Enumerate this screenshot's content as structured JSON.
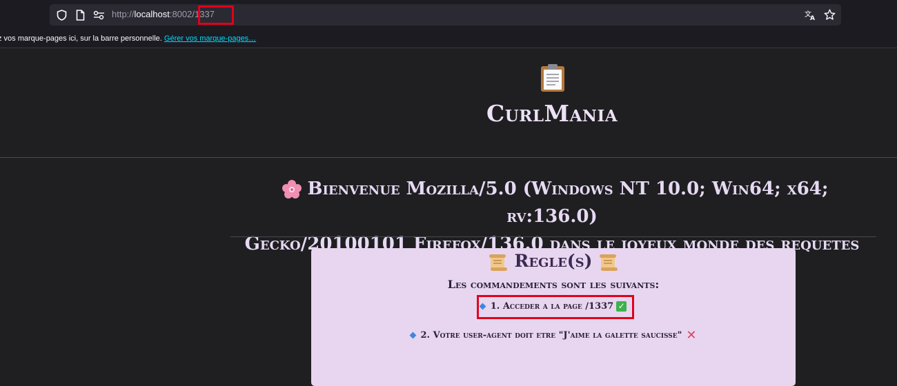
{
  "browser": {
    "url_prefix": "http://",
    "url_host": "localhost",
    "url_rest": ":8002/1337",
    "bookmarks_text": "z vos marque-pages ici, sur la barre personnelle.",
    "bookmarks_link": "Gérer vos marque-pages…",
    "icons": [
      "shield-icon",
      "page-icon",
      "site-permissions-icon",
      "translate-icon",
      "star-icon"
    ]
  },
  "page": {
    "hero_icon": "clipboard-icon",
    "title": "CurlMania",
    "welcome_line1": "Bienvenue Mozilla/5.0 (Windows NT 10.0; Win64; x64; rv:136.0)",
    "welcome_line2": "Gecko/20100101 Firefox/136.0 dans le joyeux monde des requetes",
    "flower_icon": "cherry-blossom-icon"
  },
  "rules": {
    "title": "Regle(s)",
    "subtitle": "Les commandements sont les suivants:",
    "items": [
      {
        "text": "1. Acceder a la page /1337",
        "status": "check"
      },
      {
        "text": "2. Votre user-agent doit etre \"J'aime la galette saucisse\"",
        "status": "cross"
      }
    ]
  },
  "colors": {
    "accent_red": "#e0001b",
    "card_bg": "#e8d6f0",
    "title_text": "#ece1f5"
  }
}
